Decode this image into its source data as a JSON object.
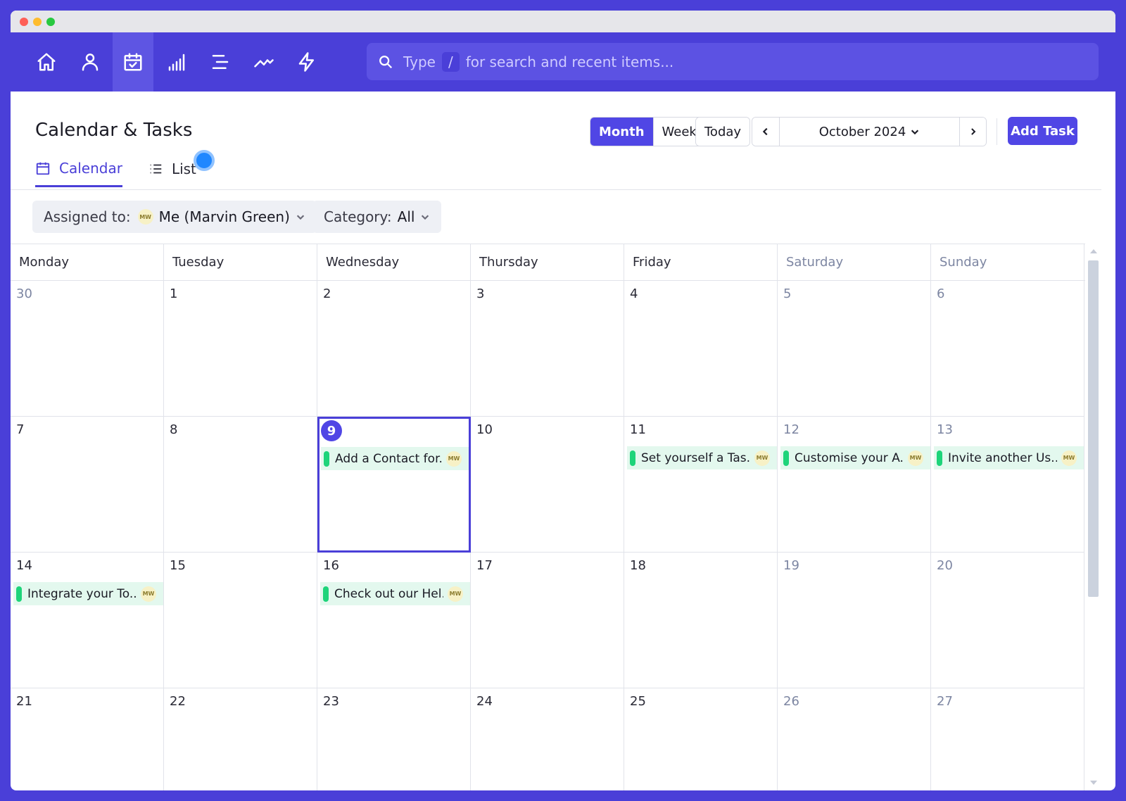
{
  "nav": {
    "icons": [
      "home-icon",
      "user-icon",
      "calendar-check-icon",
      "signal-bars-icon",
      "align-lines-icon",
      "trend-line-icon",
      "lightning-icon"
    ],
    "active": "calendar-check-icon"
  },
  "search": {
    "prefix": "Type",
    "key": "/",
    "suffix": "for search and recent items..."
  },
  "page": {
    "title": "Calendar & Tasks",
    "tabs": [
      {
        "label": "Calendar",
        "active": true
      },
      {
        "label": "List",
        "active": false
      }
    ]
  },
  "toolbar": {
    "views": [
      "Month",
      "Week"
    ],
    "active_view": "Month",
    "today_label": "Today",
    "month_label": "October 2024",
    "add_task_label": "Add Task"
  },
  "filters": {
    "assigned_label": "Assigned to:",
    "assigned_value": "Me (Marvin Green)",
    "assigned_avatar": "MW",
    "category_label": "Category:",
    "category_value": "All"
  },
  "calendar": {
    "weekdays": [
      "Monday",
      "Tuesday",
      "Wednesday",
      "Thursday",
      "Friday",
      "Saturday",
      "Sunday"
    ],
    "weeks": [
      [
        {
          "d": "30",
          "muted": true
        },
        {
          "d": "1"
        },
        {
          "d": "2"
        },
        {
          "d": "3"
        },
        {
          "d": "4"
        },
        {
          "d": "5"
        },
        {
          "d": "6"
        }
      ],
      [
        {
          "d": "7"
        },
        {
          "d": "8"
        },
        {
          "d": "9",
          "today": true,
          "task": "Add a Contact for..."
        },
        {
          "d": "10"
        },
        {
          "d": "11",
          "task": "Set yourself a Tas..."
        },
        {
          "d": "12",
          "task": "Customise your A..."
        },
        {
          "d": "13",
          "task": "Invite another Us..."
        }
      ],
      [
        {
          "d": "14",
          "task": "Integrate your To..."
        },
        {
          "d": "15"
        },
        {
          "d": "16",
          "task": "Check out our Hel..."
        },
        {
          "d": "17"
        },
        {
          "d": "18"
        },
        {
          "d": "19"
        },
        {
          "d": "20"
        }
      ],
      [
        {
          "d": "21"
        },
        {
          "d": "22"
        },
        {
          "d": "23"
        },
        {
          "d": "24"
        },
        {
          "d": "25"
        },
        {
          "d": "26"
        },
        {
          "d": "27"
        }
      ]
    ],
    "task_avatar": "MW"
  },
  "colors": {
    "accent": "#4a3fd8",
    "task_bg": "#e3f8ee",
    "task_bar": "#1ed47a"
  }
}
